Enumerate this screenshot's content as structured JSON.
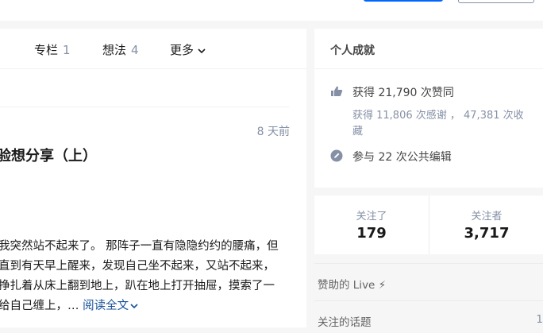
{
  "header": {},
  "tabs": [
    {
      "label": "",
      "count": ""
    },
    {
      "label": "专栏",
      "count": "1"
    },
    {
      "label": "想法",
      "count": "4"
    }
  ],
  "more_label": "更多",
  "article": {
    "date": "8 天前",
    "title": "验想分享（上）",
    "lines": [
      "我突然站不起来了。 那阵子一直有隐隐约约的腰痛，但",
      "直到有天早上醒来，发现自己坐不起来，又站不起来，",
      "挣扎着从床上翻到地上，趴在地上打开抽屉，摸索了一",
      "给自己缠上，… "
    ],
    "read_more": "阅读全文"
  },
  "achievements": {
    "title": "个人成就",
    "likes": "获得 21,790 次赞同",
    "thanks": "获得 11,806 次感谢 ， 47,381 次收藏",
    "edits": "参与 22 次公共编辑"
  },
  "follow": {
    "following_label": "关注了",
    "following_count": "179",
    "followers_label": "关注者",
    "followers_count": "3,717"
  },
  "sidebar": {
    "live_label": "赞助的 Live ⚡",
    "topics_label": "关注的话题",
    "topics_count": "1"
  },
  "colors": {
    "accent": "#0066ff",
    "muted": "#8590a6",
    "link": "#175199"
  }
}
